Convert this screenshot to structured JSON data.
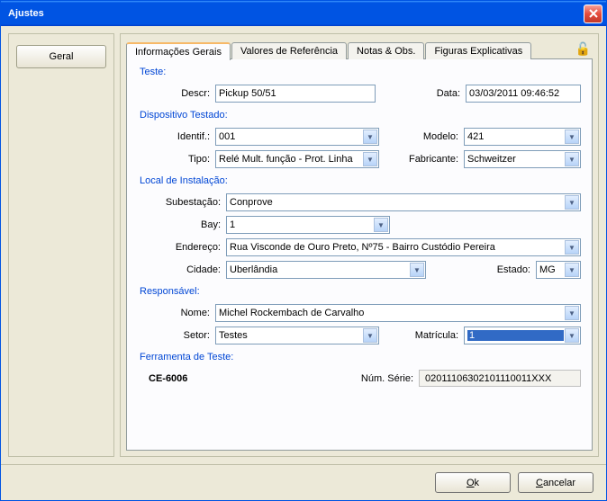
{
  "window": {
    "title": "Ajustes"
  },
  "left": {
    "geral": "Geral"
  },
  "tabs": {
    "t0": "Informações Gerais",
    "t1": "Valores de Referência",
    "t2": "Notas & Obs.",
    "t3": "Figuras Explicativas"
  },
  "groups": {
    "teste": "Teste:",
    "dispositivo": "Dispositivo Testado:",
    "local": "Local de Instalação:",
    "responsavel": "Responsável:",
    "ferramenta": "Ferramenta de Teste:"
  },
  "labels": {
    "descr": "Descr:",
    "data": "Data:",
    "identif": "Identif.:",
    "modelo": "Modelo:",
    "tipo": "Tipo:",
    "fabricante": "Fabricante:",
    "subestacao": "Subestação:",
    "bay": "Bay:",
    "endereco": "Endereço:",
    "cidade": "Cidade:",
    "estado": "Estado:",
    "nome": "Nome:",
    "setor": "Setor:",
    "matricula": "Matrícula:",
    "numserie": "Núm. Série:"
  },
  "values": {
    "descr": "Pickup 50/51",
    "data": "03/03/2011 09:46:52",
    "identif": "001",
    "modelo": "421",
    "tipo": "Relé Mult. função - Prot. Linha",
    "fabricante": "Schweitzer",
    "subestacao": "Conprove",
    "bay": "1",
    "endereco": "Rua Visconde de Ouro Preto, Nº75 - Bairro Custódio Pereira",
    "cidade": "Uberlândia",
    "estado": "MG",
    "nome": "Michel Rockembach de Carvalho",
    "setor": "Testes",
    "matricula": "1",
    "tool": "CE-6006",
    "serial": "02011106302101110011XXX"
  },
  "buttons": {
    "ok": "Ok",
    "cancelar": "Cancelar"
  },
  "lock_glyph": "🔓"
}
